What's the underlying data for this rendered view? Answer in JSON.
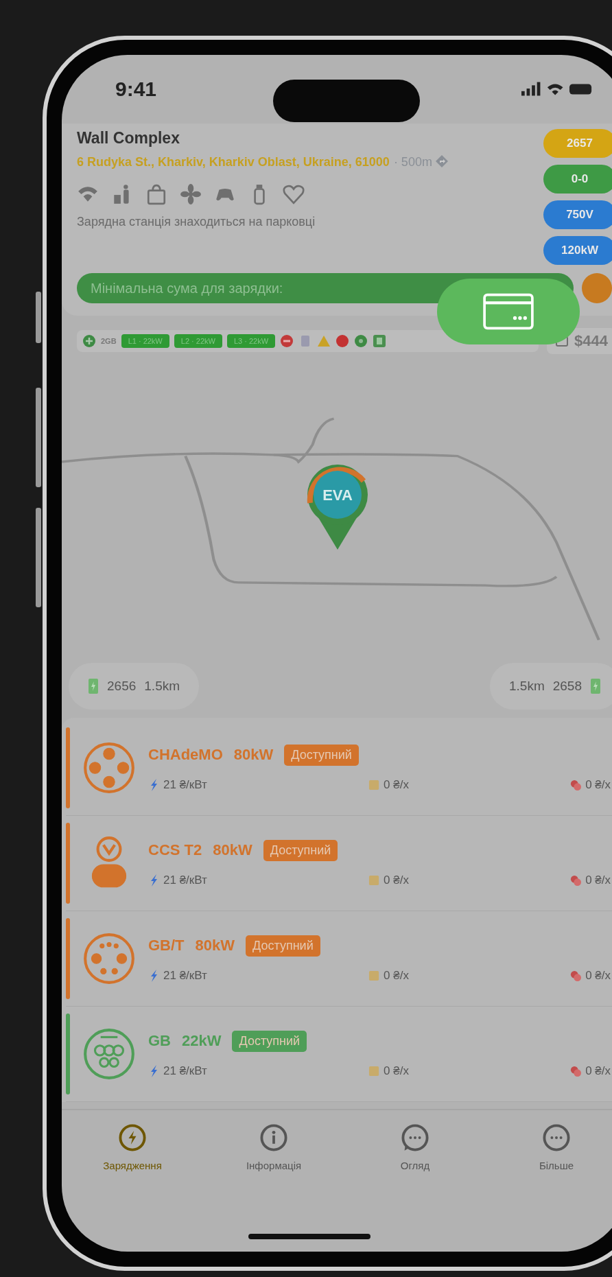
{
  "status_bar": {
    "time": "9:41"
  },
  "station": {
    "name": "Wall Complex",
    "address": "6 Rudyka St., Kharkiv, Kharkiv Oblast, Ukraine, 61000",
    "distance": "· 500m",
    "description": "Зарядна станція знаходиться на парковці",
    "min_sum_label": "Мінімальна сума для зарядки:",
    "badges": [
      {
        "text": "2657",
        "color": "#d4a514"
      },
      {
        "text": "0-0",
        "color": "#3e9a45"
      },
      {
        "text": "750V",
        "color": "#2b7bd0"
      },
      {
        "text": "120kW",
        "color": "#2b7bd0"
      }
    ]
  },
  "status_strip": {
    "label": "2GB",
    "lines": [
      "L1 · 22kW",
      "L2 · 22kW",
      "L3 · 22kW"
    ],
    "price": "$444"
  },
  "map_pin": {
    "label": "EVA"
  },
  "nearby": [
    {
      "number": "2656",
      "distance": "1.5km"
    },
    {
      "number": "2658",
      "distance": "1.5km"
    }
  ],
  "connectors": [
    {
      "kind": "chademo",
      "name": "CHAdeMO",
      "power": "80kW",
      "status": "Доступний",
      "color": "#d2732c",
      "energy_price": "21 ₴/кВт",
      "parking_price": "0 ₴/х",
      "idle_price": "0 ₴/х"
    },
    {
      "kind": "ccs2",
      "name": "CCS T2",
      "power": "80kW",
      "status": "Доступний",
      "color": "#d2732c",
      "energy_price": "21 ₴/кВт",
      "parking_price": "0 ₴/х",
      "idle_price": "0 ₴/х"
    },
    {
      "kind": "gbt",
      "name": "GB/T",
      "power": "80kW",
      "status": "Доступний",
      "color": "#d2732c",
      "energy_price": "21 ₴/кВт",
      "parking_price": "0 ₴/х",
      "idle_price": "0 ₴/х"
    },
    {
      "kind": "gb",
      "name": "GB",
      "power": "22kW",
      "status": "Доступний",
      "color": "#4f9e58",
      "energy_price": "21 ₴/кВт",
      "parking_price": "0 ₴/х",
      "idle_price": "0 ₴/х"
    }
  ],
  "tabs": [
    {
      "label": "Зарядження",
      "selected": true
    },
    {
      "label": "Інформація",
      "selected": false
    },
    {
      "label": "Огляд",
      "selected": false
    },
    {
      "label": "Більше",
      "selected": false
    }
  ]
}
